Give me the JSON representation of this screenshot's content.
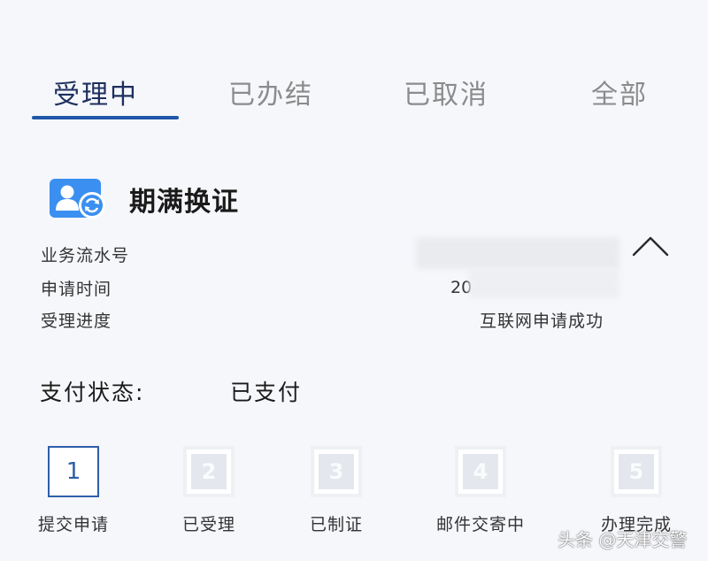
{
  "tabs": [
    {
      "label": "受理中",
      "active": true
    },
    {
      "label": "已办结",
      "active": false
    },
    {
      "label": "已取消",
      "active": false
    },
    {
      "label": "全部",
      "active": false
    }
  ],
  "service": {
    "title": "期满换证",
    "icon": "user-renew-icon"
  },
  "info": {
    "serial_label": "业务流水号",
    "date_label": "申请时间",
    "progress_label": "受理进度",
    "date_value_prefix": "20",
    "progress_value": "互联网申请成功"
  },
  "payment": {
    "label": "支付状态:",
    "value": "已支付"
  },
  "steps": [
    {
      "number": "1",
      "label": "提交申请",
      "state": "done"
    },
    {
      "number": "2",
      "label": "已受理",
      "state": "pending"
    },
    {
      "number": "3",
      "label": "已制证",
      "state": "pending"
    },
    {
      "number": "4",
      "label": "邮件交寄中",
      "state": "pending"
    },
    {
      "number": "5",
      "label": "办理完成",
      "state": "pending"
    }
  ],
  "watermark": "头条 @天津交警",
  "colors": {
    "accent": "#1f56a8",
    "active_tab": "#1d2f5e",
    "inactive_tab": "#8b8b8b",
    "background": "#f6f7fb"
  }
}
